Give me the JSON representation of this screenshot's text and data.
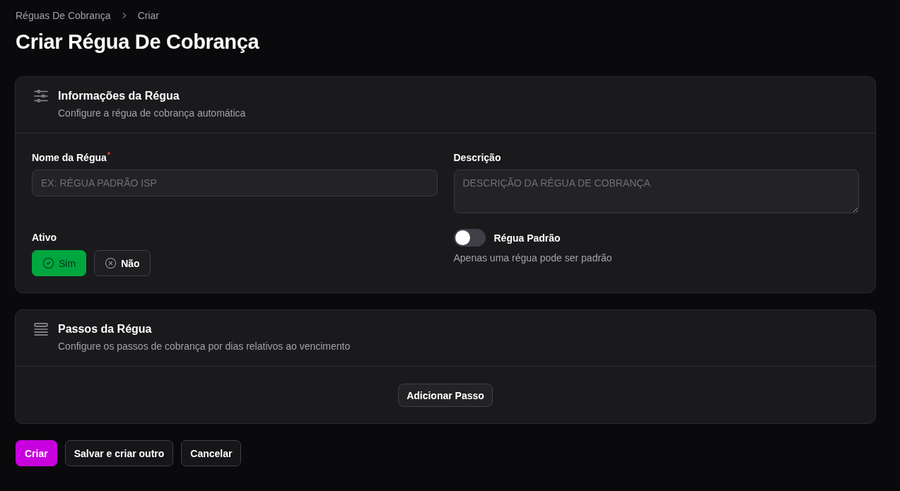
{
  "breadcrumbs": [
    {
      "label": "Réguas De Cobrança"
    },
    {
      "label": "Criar"
    }
  ],
  "page_title": "Criar Régua De Cobrança",
  "info_section": {
    "title": "Informações da Régua",
    "subtitle": "Configure a régua de cobrança automática",
    "name_field": {
      "label": "Nome da Régua",
      "required_mark": "*",
      "placeholder": "EX: RÉGUA PADRÃO ISP"
    },
    "description_field": {
      "label": "Descrição",
      "placeholder": "DESCRIÇÃO DA RÉGUA DE COBRANÇA"
    },
    "active": {
      "label": "Ativo",
      "options": [
        {
          "kind": "yes",
          "label": "Sim",
          "selected": true
        },
        {
          "kind": "no",
          "label": "Não",
          "selected": false
        }
      ]
    },
    "default_toggle": {
      "label": "Régua Padrão",
      "on": false,
      "hint": "Apenas uma régua pode ser padrão"
    }
  },
  "steps_section": {
    "title": "Passos da Régua",
    "subtitle": "Configure os passos de cobrança por dias relativos ao vencimento",
    "add_button": "Adicionar Passo"
  },
  "actions": [
    {
      "kind": "create",
      "label": "Criar"
    },
    {
      "kind": "save_another",
      "label": "Salvar e criar outro"
    },
    {
      "kind": "cancel",
      "label": "Cancelar"
    }
  ]
}
